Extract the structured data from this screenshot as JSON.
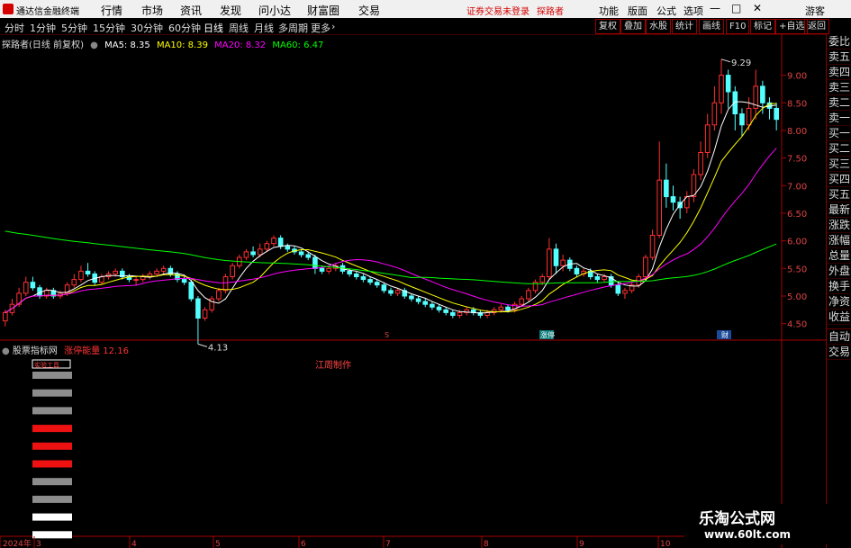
{
  "menubar": {
    "app_name": "通达信金融终端",
    "menus": [
      "行情",
      "市场",
      "资讯",
      "发现",
      "问小达",
      "财富圈",
      "交易"
    ],
    "login_notice": "证券交易未登录",
    "user": "探路者",
    "right_items": [
      "功能",
      "版面",
      "公式",
      "选项"
    ],
    "guest": "游客"
  },
  "toolbar": {
    "periods": [
      "分时",
      "1分钟",
      "5分钟",
      "15分钟",
      "30分钟",
      "60分钟",
      "日线",
      "周线",
      "月线",
      "多周期",
      "更多"
    ],
    "active_period": "日线",
    "buttons": [
      "复权",
      "叠加",
      "水股",
      "统计",
      "画线",
      "F10",
      "标记",
      "+自选",
      "返回"
    ]
  },
  "legend": {
    "stock": "探路者(日线 前复权)",
    "ma5": "MA5: 8.35",
    "ma10": "MA10: 8.39",
    "ma20": "MA20: 8.32",
    "ma60": "MA60: 6.47",
    "colors": {
      "ma5": "#ffffff",
      "ma10": "#ffff00",
      "ma20": "#ff00ff",
      "ma60": "#00ff00"
    }
  },
  "side_panel": [
    "委比",
    "卖五",
    "卖四",
    "卖三",
    "卖二",
    "卖一",
    "买一",
    "买二",
    "买三",
    "买四",
    "买五",
    "最新",
    "涨跌",
    "涨幅",
    "总量",
    "外盘",
    "换手",
    "净资",
    "收益",
    "自动",
    "交易"
  ],
  "indicator": {
    "name": "股票指标网",
    "label": "涨停能量",
    "value": "12.16",
    "tag": "江周制作",
    "box_label": "实验工具"
  },
  "chart_data": {
    "type": "candlestick",
    "y_ticks": [
      "9.00",
      "8.50",
      "8.00",
      "7.50",
      "7.00",
      "6.50",
      "6.00",
      "5.50",
      "5.00",
      "4.50"
    ],
    "ylim": [
      4.25,
      9.45
    ],
    "x_labels": [
      "2024年",
      "3",
      "4",
      "5",
      "6",
      "7",
      "8",
      "9",
      "10"
    ],
    "high_label": "9.29",
    "low_label": "4.13",
    "event_markers": [
      "S",
      "涨停",
      "财"
    ],
    "candles": [
      [
        4.55,
        4.7,
        4.45,
        4.75
      ],
      [
        4.7,
        4.85,
        4.65,
        4.95
      ],
      [
        4.85,
        5.05,
        4.8,
        5.15
      ],
      [
        5.05,
        5.25,
        5.0,
        5.35
      ],
      [
        5.25,
        5.15,
        5.1,
        5.35
      ],
      [
        5.15,
        5.0,
        4.95,
        5.2
      ],
      [
        5.0,
        5.1,
        4.95,
        5.15
      ],
      [
        5.1,
        5.0,
        4.95,
        5.15
      ],
      [
        5.0,
        5.05,
        4.95,
        5.1
      ],
      [
        5.05,
        5.2,
        5.0,
        5.25
      ],
      [
        5.2,
        5.3,
        5.15,
        5.4
      ],
      [
        5.3,
        5.45,
        5.25,
        5.55
      ],
      [
        5.45,
        5.4,
        5.35,
        5.6
      ],
      [
        5.4,
        5.25,
        5.2,
        5.45
      ],
      [
        5.25,
        5.35,
        5.2,
        5.4
      ],
      [
        5.35,
        5.4,
        5.3,
        5.45
      ],
      [
        5.4,
        5.45,
        5.35,
        5.5
      ],
      [
        5.45,
        5.35,
        5.3,
        5.5
      ],
      [
        5.35,
        5.3,
        5.25,
        5.4
      ],
      [
        5.3,
        5.3,
        5.2,
        5.35
      ],
      [
        5.3,
        5.35,
        5.25,
        5.4
      ],
      [
        5.35,
        5.4,
        5.3,
        5.45
      ],
      [
        5.4,
        5.45,
        5.35,
        5.5
      ],
      [
        5.45,
        5.5,
        5.4,
        5.55
      ],
      [
        5.5,
        5.4,
        5.35,
        5.55
      ],
      [
        5.4,
        5.3,
        5.25,
        5.45
      ],
      [
        5.3,
        5.25,
        5.2,
        5.35
      ],
      [
        5.25,
        4.95,
        4.9,
        5.3
      ],
      [
        4.95,
        4.6,
        4.13,
        5.0
      ],
      [
        4.6,
        4.75,
        4.55,
        4.8
      ],
      [
        4.75,
        4.95,
        4.7,
        5.0
      ],
      [
        4.95,
        5.1,
        4.9,
        5.15
      ],
      [
        5.1,
        5.35,
        5.05,
        5.4
      ],
      [
        5.35,
        5.55,
        5.3,
        5.6
      ],
      [
        5.55,
        5.7,
        5.5,
        5.75
      ],
      [
        5.7,
        5.8,
        5.65,
        5.85
      ],
      [
        5.8,
        5.75,
        5.7,
        5.9
      ],
      [
        5.75,
        5.85,
        5.7,
        5.95
      ],
      [
        5.85,
        5.95,
        5.8,
        6.0
      ],
      [
        5.95,
        6.05,
        5.9,
        6.1
      ],
      [
        6.05,
        5.9,
        5.85,
        6.1
      ],
      [
        5.9,
        5.85,
        5.8,
        5.95
      ],
      [
        5.85,
        5.8,
        5.75,
        5.9
      ],
      [
        5.8,
        5.75,
        5.7,
        5.85
      ],
      [
        5.75,
        5.7,
        5.65,
        5.8
      ],
      [
        5.7,
        5.5,
        5.4,
        5.75
      ],
      [
        5.5,
        5.45,
        5.4,
        5.55
      ],
      [
        5.45,
        5.5,
        5.4,
        5.55
      ],
      [
        5.5,
        5.55,
        5.45,
        5.6
      ],
      [
        5.55,
        5.45,
        5.4,
        5.6
      ],
      [
        5.45,
        5.4,
        5.35,
        5.5
      ],
      [
        5.4,
        5.35,
        5.3,
        5.45
      ],
      [
        5.35,
        5.3,
        5.25,
        5.4
      ],
      [
        5.3,
        5.25,
        5.2,
        5.35
      ],
      [
        5.25,
        5.2,
        5.15,
        5.3
      ],
      [
        5.2,
        5.1,
        5.05,
        5.25
      ],
      [
        5.1,
        5.05,
        5.0,
        5.15
      ],
      [
        5.05,
        5.1,
        5.0,
        5.15
      ],
      [
        5.1,
        5.0,
        4.95,
        5.15
      ],
      [
        5.0,
        4.95,
        4.9,
        5.05
      ],
      [
        4.95,
        4.9,
        4.85,
        5.0
      ],
      [
        4.9,
        4.85,
        4.8,
        4.95
      ],
      [
        4.85,
        4.8,
        4.75,
        4.9
      ],
      [
        4.8,
        4.75,
        4.7,
        4.85
      ],
      [
        4.75,
        4.7,
        4.65,
        4.8
      ],
      [
        4.7,
        4.65,
        4.6,
        4.75
      ],
      [
        4.65,
        4.7,
        4.6,
        4.75
      ],
      [
        4.7,
        4.75,
        4.65,
        4.8
      ],
      [
        4.75,
        4.7,
        4.65,
        4.8
      ],
      [
        4.7,
        4.65,
        4.6,
        4.75
      ],
      [
        4.65,
        4.7,
        4.6,
        4.75
      ],
      [
        4.7,
        4.75,
        4.65,
        4.8
      ],
      [
        4.75,
        4.8,
        4.7,
        4.85
      ],
      [
        4.8,
        4.75,
        4.7,
        4.85
      ],
      [
        4.75,
        4.85,
        4.7,
        4.9
      ],
      [
        4.85,
        4.95,
        4.8,
        5.0
      ],
      [
        4.95,
        5.1,
        4.9,
        5.15
      ],
      [
        5.1,
        5.25,
        5.05,
        5.3
      ],
      [
        5.25,
        5.35,
        5.2,
        5.4
      ],
      [
        5.35,
        5.85,
        5.3,
        6.05
      ],
      [
        5.85,
        5.55,
        5.4,
        5.95
      ],
      [
        5.55,
        5.65,
        5.45,
        5.75
      ],
      [
        5.65,
        5.5,
        5.45,
        5.7
      ],
      [
        5.5,
        5.4,
        5.35,
        5.55
      ],
      [
        5.4,
        5.45,
        5.35,
        5.5
      ],
      [
        5.45,
        5.35,
        5.3,
        5.5
      ],
      [
        5.35,
        5.3,
        5.25,
        5.4
      ],
      [
        5.3,
        5.35,
        5.25,
        5.4
      ],
      [
        5.35,
        5.2,
        5.15,
        5.4
      ],
      [
        5.2,
        5.05,
        5.0,
        5.25
      ],
      [
        5.05,
        5.1,
        4.95,
        5.15
      ],
      [
        5.1,
        5.2,
        5.05,
        5.25
      ],
      [
        5.2,
        5.35,
        5.15,
        5.4
      ],
      [
        5.35,
        5.7,
        5.3,
        5.75
      ],
      [
        5.7,
        6.1,
        5.65,
        6.2
      ],
      [
        6.1,
        7.1,
        6.05,
        7.8
      ],
      [
        7.1,
        6.8,
        6.6,
        7.4
      ],
      [
        6.8,
        6.7,
        6.55,
        7.0
      ],
      [
        6.7,
        6.6,
        6.4,
        6.8
      ],
      [
        6.6,
        6.8,
        6.5,
        6.9
      ],
      [
        6.8,
        7.2,
        6.7,
        7.3
      ],
      [
        7.2,
        7.6,
        7.1,
        7.8
      ],
      [
        7.6,
        8.1,
        7.5,
        8.3
      ],
      [
        8.1,
        8.5,
        8.0,
        8.8
      ],
      [
        8.5,
        9.0,
        8.3,
        9.29
      ],
      [
        9.0,
        8.7,
        8.4,
        9.1
      ],
      [
        8.7,
        8.3,
        8.0,
        8.8
      ],
      [
        8.3,
        8.1,
        7.9,
        8.4
      ],
      [
        8.1,
        8.4,
        8.0,
        8.6
      ],
      [
        8.4,
        8.8,
        8.2,
        9.1
      ],
      [
        8.8,
        8.5,
        8.3,
        8.9
      ],
      [
        8.5,
        8.4,
        8.2,
        8.6
      ],
      [
        8.4,
        8.2,
        8.0,
        8.5
      ]
    ],
    "indicator_bars": [
      "gray",
      "gray",
      "gray",
      "red",
      "red",
      "red",
      "gray",
      "gray",
      "white",
      "white"
    ]
  }
}
